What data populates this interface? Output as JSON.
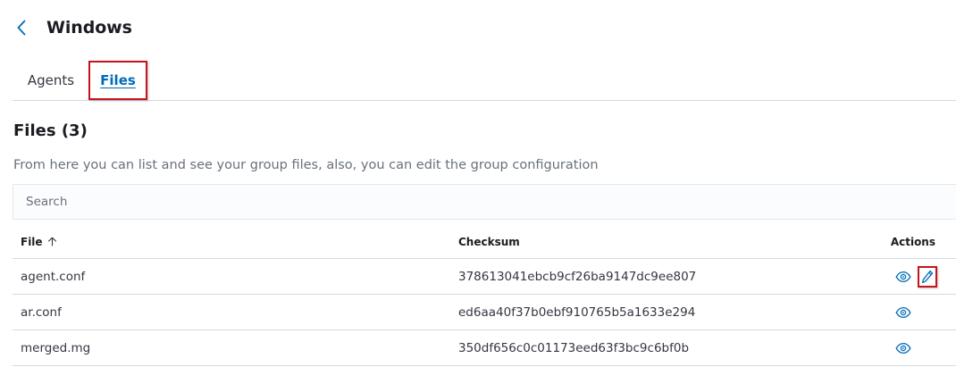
{
  "header": {
    "title": "Windows",
    "back_icon": "chevron-left-icon"
  },
  "tabs": [
    {
      "label": "Agents",
      "selected": false
    },
    {
      "label": "Files",
      "selected": true
    }
  ],
  "section": {
    "title": "Files (3)",
    "description": "From here you can list and see your group files, also, you can edit the group configuration"
  },
  "search": {
    "placeholder": "Search",
    "value": ""
  },
  "table": {
    "columns": {
      "file": "File",
      "checksum": "Checksum",
      "actions": "Actions"
    },
    "sort": {
      "column": "file",
      "direction": "ascending",
      "icon": "arrow-up-icon"
    },
    "rows": [
      {
        "file": "agent.conf",
        "checksum": "378613041ebcb9cf26ba9147dc9ee807",
        "actions": [
          "eye-icon",
          "pencil-icon"
        ]
      },
      {
        "file": "ar.conf",
        "checksum": "ed6aa40f37b0ebf910765b5a1633e294",
        "actions": [
          "eye-icon"
        ]
      },
      {
        "file": "merged.mg",
        "checksum": "350df656c0c01173eed63f3bc9c6bf0b",
        "actions": [
          "eye-icon"
        ]
      }
    ]
  },
  "colors": {
    "link": "#006bb8",
    "highlight": "#c4141c",
    "text": "#343741",
    "muted": "#69707d",
    "border": "#d3dae6"
  }
}
